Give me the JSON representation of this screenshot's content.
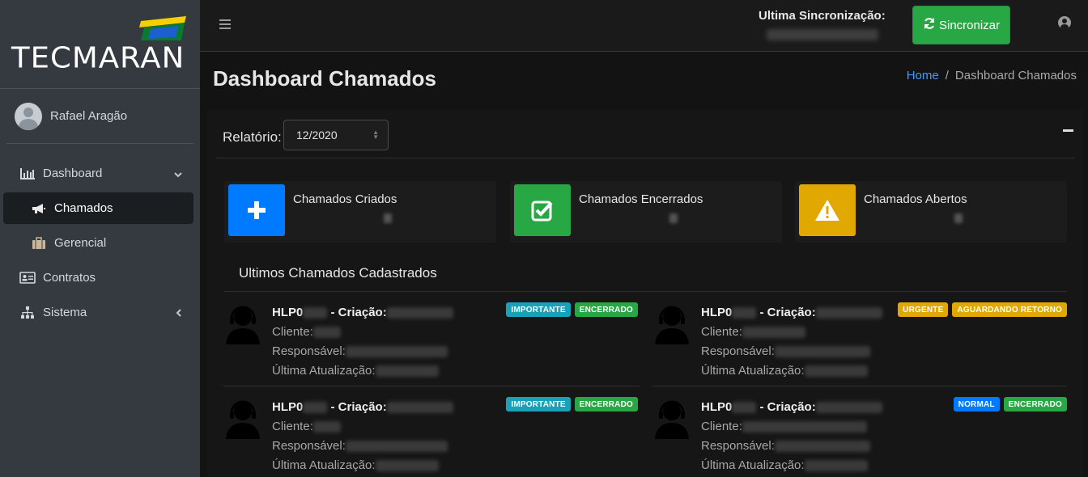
{
  "sidebar": {
    "brand": "TECMARAN",
    "user_name": "Rafael Aragão",
    "items": [
      {
        "label": "Dashboard",
        "icon": "bar-chart-icon"
      },
      {
        "label": "Chamados",
        "icon": "megaphone-icon"
      },
      {
        "label": "Gerencial",
        "icon": "briefcase-icon"
      },
      {
        "label": "Contratos",
        "icon": "id-card-icon"
      },
      {
        "label": "Sistema",
        "icon": "sitemap-icon"
      }
    ]
  },
  "header": {
    "sync_label": "Ultima Sincronização:",
    "sync_button": "Sincronizar",
    "sync_button_color": "#28a745"
  },
  "content": {
    "title": "Dashboard Chamados",
    "breadcrumb": {
      "home": "Home",
      "separator": "/",
      "current": "Dashboard Chamados"
    },
    "report_label": "Relatório:",
    "report_value": "12/2020",
    "info_boxes": [
      {
        "label": "Chamados Criados",
        "color": "#007bff",
        "icon": "plus-icon"
      },
      {
        "label": "Chamados Encerrados",
        "color": "#28a745",
        "icon": "check-square-icon"
      },
      {
        "label": "Chamados Abertos",
        "color": "#ffc107",
        "icon": "warning-icon"
      }
    ],
    "section_title": "Ultimos Chamados Cadastrados",
    "ticket_labels": {
      "id_prefix": "HLP0",
      "creation": "- Criação:",
      "client": "Cliente:",
      "responsible": "Responsável:",
      "updated": "Última Atualização:"
    },
    "tickets": [
      {
        "badges": [
          {
            "text": "IMPORTANTE",
            "color": "#17a2b8"
          },
          {
            "text": "ENCERRADO",
            "color": "#28a745"
          }
        ]
      },
      {
        "badges": [
          {
            "text": "URGENTE",
            "color": "#ffc107"
          },
          {
            "text": "AGUARDANDO RETORNO",
            "color": "#ffc107"
          }
        ]
      },
      {
        "badges": [
          {
            "text": "IMPORTANTE",
            "color": "#17a2b8"
          },
          {
            "text": "ENCERRADO",
            "color": "#28a745"
          }
        ]
      },
      {
        "badges": [
          {
            "text": "NORMAL",
            "color": "#007bff"
          },
          {
            "text": "ENCERRADO",
            "color": "#28a745"
          }
        ]
      }
    ]
  }
}
